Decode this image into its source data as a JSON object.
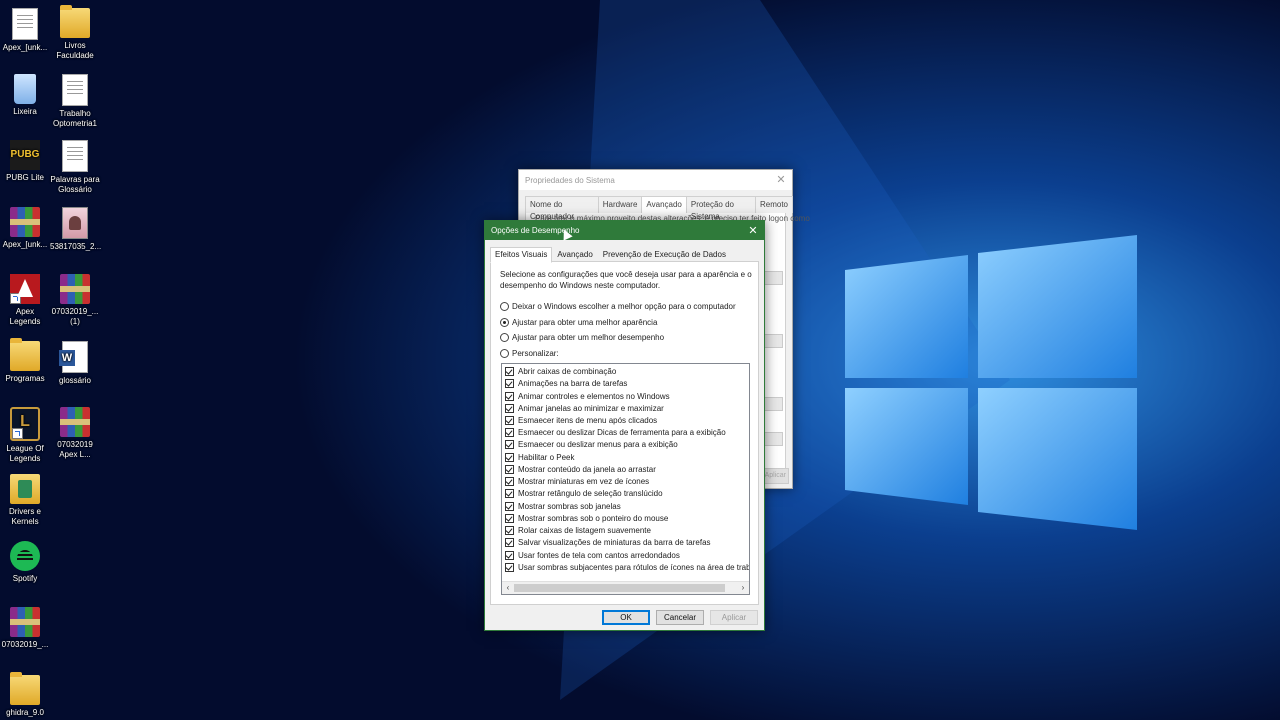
{
  "desktop": {
    "icons": [
      {
        "label": "Apex_[unk..."
      },
      {
        "label": "Livros\nFaculdade"
      },
      {
        "label": "Lixeira"
      },
      {
        "label": "Trabalho\nOptometria1"
      },
      {
        "label": "PUBG Lite"
      },
      {
        "label": "Palavras para\nGlossário"
      },
      {
        "label": "Apex_[unk..."
      },
      {
        "label": "53817035_2..."
      },
      {
        "label": "Apex\nLegends"
      },
      {
        "label": "07032019_...\n(1)"
      },
      {
        "label": "Programas"
      },
      {
        "label": "glossário"
      },
      {
        "label": "League Of\nLegends"
      },
      {
        "label": "07032019\nApex L..."
      },
      {
        "label": "Drivers e\nKernels"
      },
      {
        "label": "Spotify"
      },
      {
        "label": "07032019_..."
      },
      {
        "label": "ghidra_9.0"
      }
    ],
    "pubg_glyph": "PUBG",
    "lol_glyph": "L"
  },
  "system_properties": {
    "title": "Propriedades do Sistema",
    "tabs": [
      "Nome do Computador",
      "Hardware",
      "Avançado",
      "Proteção do Sistema",
      "Remoto"
    ],
    "active_tab": "Avançado",
    "body_text": "Para tirar o máximo proveito destas alterações, é preciso ter feito logon como",
    "apply_label": "Aplicar"
  },
  "performance_options": {
    "title": "Opções de Desempenho",
    "tabs": [
      "Efeitos Visuais",
      "Avançado",
      "Prevenção de Execução de Dados"
    ],
    "active_tab": "Efeitos Visuais",
    "description": "Selecione as configurações que você deseja usar para a aparência e o\ndesempenho do Windows neste computador.",
    "radios": [
      {
        "label": "Deixar o Windows escolher a melhor opção para o computador",
        "checked": false
      },
      {
        "label": "Ajustar para obter uma melhor aparência",
        "checked": true
      },
      {
        "label": "Ajustar para obter um melhor desempenho",
        "checked": false
      },
      {
        "label": "Personalizar:",
        "checked": false
      }
    ],
    "effects": [
      {
        "label": "Abrir caixas de combinação",
        "checked": true
      },
      {
        "label": "Animações na barra de tarefas",
        "checked": true
      },
      {
        "label": "Animar controles e elementos no Windows",
        "checked": true
      },
      {
        "label": "Animar janelas ao minimizar e maximizar",
        "checked": true
      },
      {
        "label": "Esmaecer itens de menu após clicados",
        "checked": true
      },
      {
        "label": "Esmaecer ou deslizar Dicas de ferramenta para a exibição",
        "checked": true
      },
      {
        "label": "Esmaecer ou deslizar menus para a exibição",
        "checked": true
      },
      {
        "label": "Habilitar o Peek",
        "checked": true
      },
      {
        "label": "Mostrar conteúdo da janela ao arrastar",
        "checked": true
      },
      {
        "label": "Mostrar miniaturas em vez de ícones",
        "checked": true
      },
      {
        "label": "Mostrar retângulo de seleção translúcido",
        "checked": true
      },
      {
        "label": "Mostrar sombras sob janelas",
        "checked": true
      },
      {
        "label": "Mostrar sombras sob o ponteiro do mouse",
        "checked": true
      },
      {
        "label": "Rolar caixas de listagem suavemente",
        "checked": true
      },
      {
        "label": "Salvar visualizações de miniaturas da barra de tarefas",
        "checked": true
      },
      {
        "label": "Usar fontes de tela com cantos arredondados",
        "checked": true
      },
      {
        "label": "Usar sombras subjacentes para rótulos de ícones na área de traball",
        "checked": true
      }
    ],
    "buttons": {
      "ok": "OK",
      "cancel": "Cancelar",
      "apply": "Aplicar"
    }
  }
}
